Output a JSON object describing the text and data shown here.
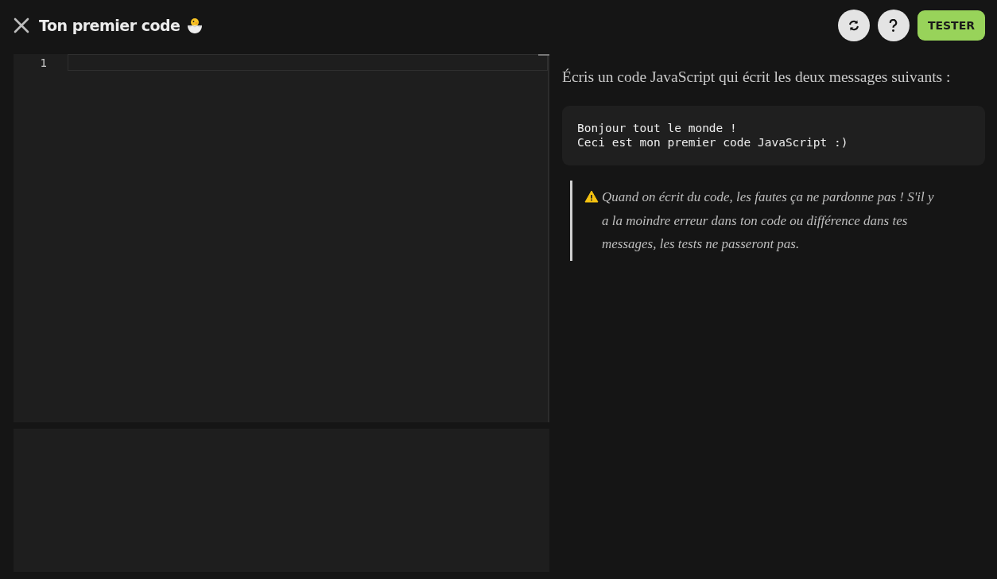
{
  "header": {
    "title": "Ton premier code",
    "buttons": [
      {
        "kind": "reset"
      },
      {
        "kind": "help"
      },
      {
        "kind": "submit",
        "label": "TESTER"
      }
    ]
  },
  "editor": {
    "line_numbers": [
      "1"
    ]
  },
  "instructions": {
    "intro": "Écris un code JavaScript qui écrit les deux messages suivants :",
    "code_lines": [
      "Bonjour tout le monde !",
      "Ceci est mon premier code JavaScript :)"
    ],
    "warning": "Quand on écrit du code, les fautes ça ne pardonne pas ! S'il y a la moindre erreur dans ton code ou différence dans tes messages, les tests ne passeront pas."
  }
}
